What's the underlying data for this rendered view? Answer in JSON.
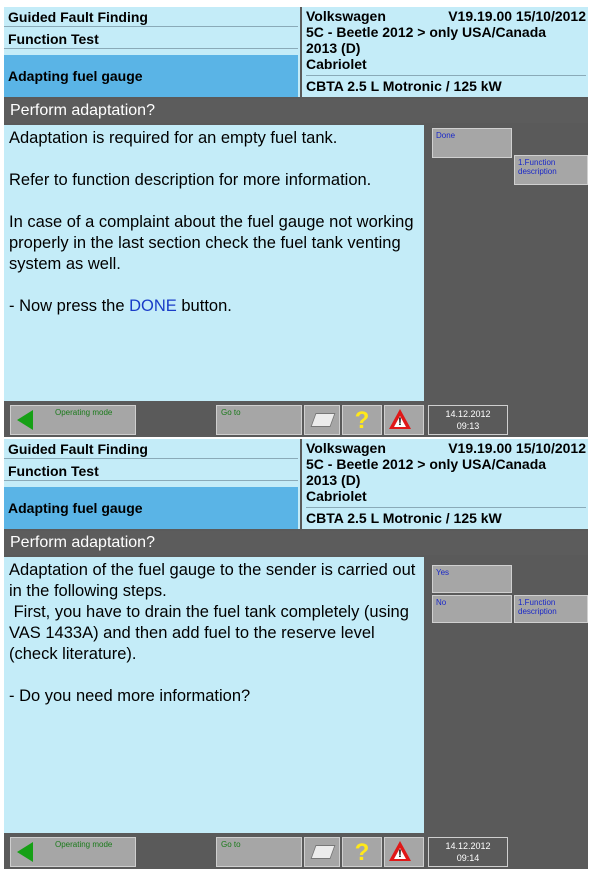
{
  "screens": [
    {
      "header": {
        "guided_fault_finding": "Guided Fault Finding",
        "function_test": "Function Test",
        "test_name": "Adapting fuel gauge",
        "make": "Volkswagen",
        "version": "V19.19.00 15/10/2012",
        "model_line": "5C - Beetle 2012 > only USA/Canada",
        "model_year": "2013 (D)",
        "body_style": "Cabriolet",
        "engine": "CBTA 2.5 L Motronic / 125 kW"
      },
      "question": "Perform adaptation?",
      "message": {
        "line1": "Adaptation is required for an empty fuel tank.",
        "line2": "Refer to function description for more information.",
        "line3": "In case of a complaint about the fuel gauge not working properly in the last section check the fuel tank venting system as well.",
        "line4_prefix": "- Now press the ",
        "line4_highlight": "DONE",
        "line4_suffix": " button."
      },
      "buttons": {
        "done": "Done",
        "function_description": "1.Function description"
      },
      "toolbar": {
        "operating_mode": "Operating mode",
        "go_to": "Go to",
        "date": "14.12.2012",
        "time": "09:13"
      }
    },
    {
      "header": {
        "guided_fault_finding": "Guided Fault Finding",
        "function_test": "Function Test",
        "test_name": "Adapting fuel gauge",
        "make": "Volkswagen",
        "version": "V19.19.00 15/10/2012",
        "model_line": "5C - Beetle 2012 > only USA/Canada",
        "model_year": "2013 (D)",
        "body_style": "Cabriolet",
        "engine": "CBTA 2.5 L Motronic / 125 kW"
      },
      "question": "Perform adaptation?",
      "message": {
        "line1": "Adaptation of the fuel gauge to the sender is carried out in the following steps.",
        "line2": " First, you have to drain the fuel tank completely (using VAS 1433A) and then add fuel to the reserve level (check literature).",
        "line3": "- Do you need more information?"
      },
      "buttons": {
        "yes": "Yes",
        "no": "No",
        "function_description": "1.Function description"
      },
      "toolbar": {
        "operating_mode": "Operating mode",
        "go_to": "Go to",
        "date": "14.12.2012",
        "time": "09:14"
      }
    }
  ],
  "colors": {
    "header_bg": "#c4ecf8",
    "selected_row": "#5ab4e6",
    "panel_gray": "#5a5a5a",
    "button_gray": "#a6a6a6",
    "highlight_blue": "#1a3cc8",
    "arrow_green": "#16a016",
    "warning_red": "#e01818",
    "help_yellow": "#ffe81a"
  },
  "icons": [
    "back-arrow-icon",
    "print-icon",
    "help-question-icon",
    "warning-icon"
  ]
}
